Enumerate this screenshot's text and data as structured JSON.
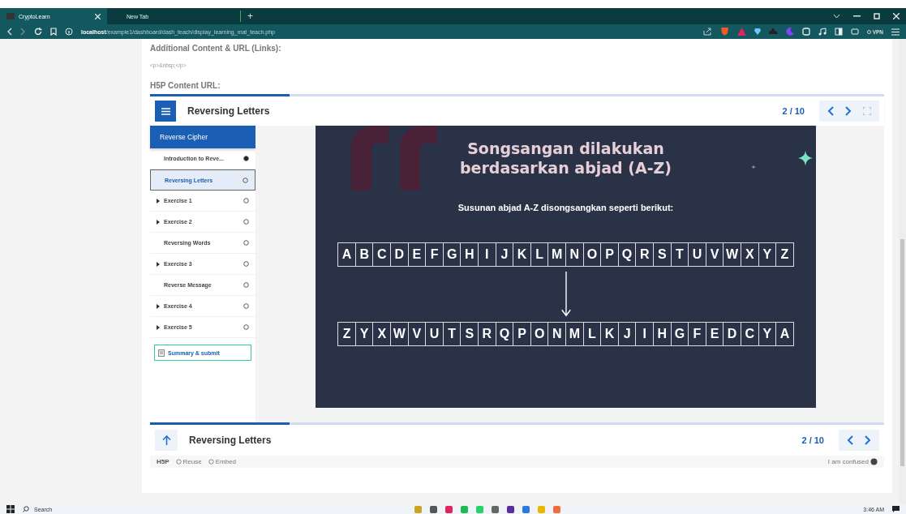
{
  "browser": {
    "tabs": [
      {
        "label": "CryptoLearn",
        "selected": true
      },
      {
        "label": "New Tab",
        "selected": false
      }
    ],
    "new_tab": "+",
    "address": {
      "host": "localhost",
      "path": "/example1/dashboard/dash_teach/display_learning_mat_teach.php"
    },
    "vpn": "VPN"
  },
  "page": {
    "additional_label": "Additional Content & URL (Links):",
    "additional_value": "<p>&nbsp;</p>",
    "h5p_label": "H5P Content URL:"
  },
  "player": {
    "title": "Reversing Letters",
    "counter": "2 / 10",
    "progress": {
      "level": 0.19
    },
    "sidebar": {
      "section": {
        "label": "Reverse Cipher",
        "selected": true
      },
      "items": [
        {
          "label": "Introduction to Reve...",
          "expandable": false,
          "done": true,
          "selected": false
        },
        {
          "label": "Reversing Letters",
          "expandable": false,
          "done": false,
          "selected": true
        },
        {
          "label": "Exercise 1",
          "expandable": true,
          "done": false,
          "selected": false
        },
        {
          "label": "Exercise 2",
          "expandable": true,
          "done": false,
          "selected": false
        },
        {
          "label": "Reversing Words",
          "expandable": false,
          "done": false,
          "selected": false
        },
        {
          "label": "Exercise 3",
          "expandable": true,
          "done": false,
          "selected": false
        },
        {
          "label": "Reverse Message",
          "expandable": false,
          "done": false,
          "selected": false
        },
        {
          "label": "Exercise 4",
          "expandable": true,
          "done": false,
          "selected": false
        },
        {
          "label": "Exercise 5",
          "expandable": true,
          "done": false,
          "selected": false
        }
      ],
      "summary": "Summary & submit"
    },
    "slide": {
      "heading": [
        "Songsangan dilakukan",
        "berdasarkan abjad (A-Z)"
      ],
      "subtitle": "Susunan abjad A-Z disongsangkan seperti berikut:",
      "row_top": [
        "A",
        "B",
        "C",
        "D",
        "E",
        "F",
        "G",
        "H",
        "I",
        "J",
        "K",
        "L",
        "M",
        "N",
        "O",
        "P",
        "Q",
        "R",
        "S",
        "T",
        "U",
        "V",
        "W",
        "X",
        "Y",
        "Z"
      ],
      "row_bottom": [
        "Z",
        "Y",
        "X",
        "W",
        "V",
        "U",
        "T",
        "S",
        "R",
        "Q",
        "P",
        "O",
        "N",
        "M",
        "L",
        "K",
        "J",
        "I",
        "H",
        "G",
        "F",
        "E",
        "D",
        "C",
        "Y",
        "A"
      ]
    },
    "footer": {
      "title": "Reversing Letters",
      "counter": "2 / 10",
      "progress": {
        "level": 0.19
      },
      "logo": "H5P",
      "actions": [
        "Reuse",
        "Embed"
      ],
      "confused": "I am confused"
    }
  },
  "taskbar": {
    "search": "Search",
    "time": "3:46 AM"
  }
}
